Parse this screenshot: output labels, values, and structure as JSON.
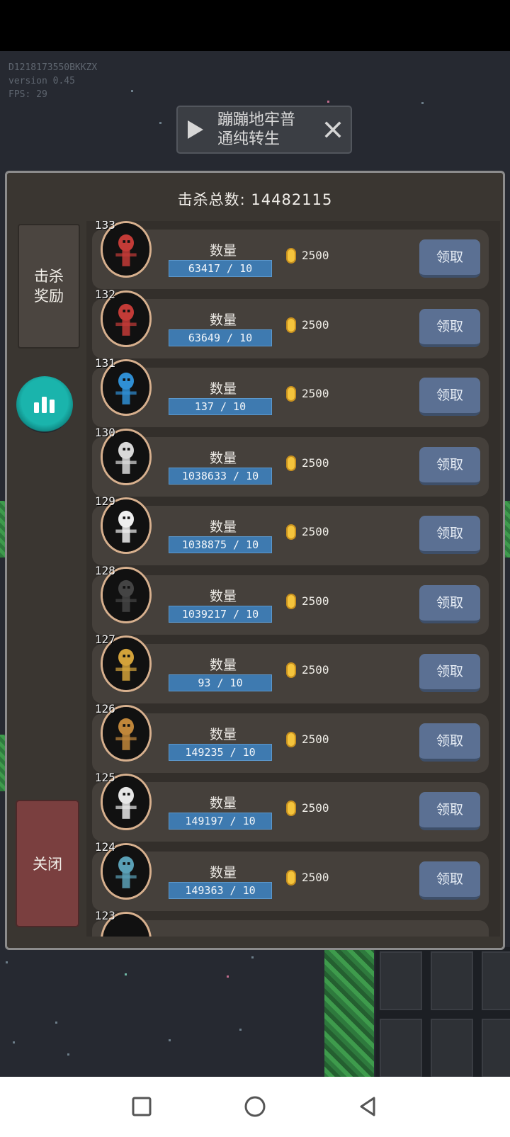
{
  "debug": {
    "device_id": "D1218173550BKKZX",
    "version": "version 0.45",
    "fps": "FPS: 29"
  },
  "ad_banner": {
    "text_line1": "蹦蹦地牢普",
    "text_line2": "通纯转生",
    "play_icon": "play-icon",
    "close_icon": "close-icon"
  },
  "dialog": {
    "title": "击杀总数: 14482115",
    "side_tab_label": "击杀奖励",
    "close_label": "关闭",
    "stats_icon": "bar-chart-icon",
    "rows": [
      {
        "rank": "133",
        "qty_label": "数量",
        "qty": "63417 / 10",
        "reward": "2500",
        "claim": "领取",
        "tint": "#c33b37"
      },
      {
        "rank": "132",
        "qty_label": "数量",
        "qty": "63649 / 10",
        "reward": "2500",
        "claim": "领取",
        "tint": "#c33b37"
      },
      {
        "rank": "131",
        "qty_label": "数量",
        "qty": "137 / 10",
        "reward": "2500",
        "claim": "领取",
        "tint": "#2f8fd4"
      },
      {
        "rank": "130",
        "qty_label": "数量",
        "qty": "1038633 / 10",
        "reward": "2500",
        "claim": "领取",
        "tint": "#d9d9d9"
      },
      {
        "rank": "129",
        "qty_label": "数量",
        "qty": "1038875 / 10",
        "reward": "2500",
        "claim": "领取",
        "tint": "#eeeeee"
      },
      {
        "rank": "128",
        "qty_label": "数量",
        "qty": "1039217 / 10",
        "reward": "2500",
        "claim": "领取",
        "tint": "#444444"
      },
      {
        "rank": "127",
        "qty_label": "数量",
        "qty": "93 / 10",
        "reward": "2500",
        "claim": "领取",
        "tint": "#d3a23a"
      },
      {
        "rank": "126",
        "qty_label": "数量",
        "qty": "149235 / 10",
        "reward": "2500",
        "claim": "领取",
        "tint": "#c0863a"
      },
      {
        "rank": "125",
        "qty_label": "数量",
        "qty": "149197 / 10",
        "reward": "2500",
        "claim": "领取",
        "tint": "#e6e6e6"
      },
      {
        "rank": "124",
        "qty_label": "数量",
        "qty": "149363 / 10",
        "reward": "2500",
        "claim": "领取",
        "tint": "#5aa0b6"
      }
    ],
    "partial_rank": "123"
  },
  "navbar": {
    "recent_icon": "square-recent-apps-icon",
    "home_icon": "circle-home-icon",
    "back_icon": "triangle-back-icon"
  }
}
